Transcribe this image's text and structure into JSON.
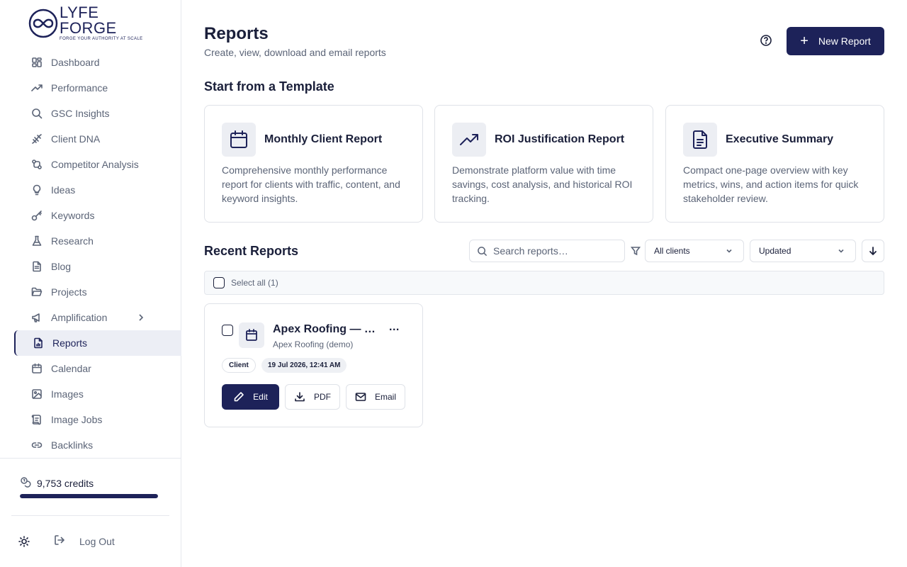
{
  "brand": {
    "name": "LYFE FORGE",
    "tagline": "FORGE YOUR AUTHORITY AT SCALE"
  },
  "sidebar": {
    "items": [
      {
        "label": "Dashboard",
        "icon": "dashboard-icon"
      },
      {
        "label": "Performance",
        "icon": "trending-up-icon"
      },
      {
        "label": "GSC Insights",
        "icon": "search-icon"
      },
      {
        "label": "Client DNA",
        "icon": "dna-icon"
      },
      {
        "label": "Competitor Analysis",
        "icon": "compare-icon"
      },
      {
        "label": "Ideas",
        "icon": "lightbulb-icon"
      },
      {
        "label": "Keywords",
        "icon": "key-icon"
      },
      {
        "label": "Research",
        "icon": "flask-icon"
      },
      {
        "label": "Blog",
        "icon": "document-icon"
      },
      {
        "label": "Projects",
        "icon": "folder-open-icon"
      },
      {
        "label": "Amplification",
        "icon": "megaphone-icon"
      },
      {
        "label": "Reports",
        "icon": "report-icon",
        "active": true
      },
      {
        "label": "Calendar",
        "icon": "calendar-icon"
      },
      {
        "label": "Images",
        "icon": "image-icon"
      },
      {
        "label": "Image Jobs",
        "icon": "image-jobs-icon"
      },
      {
        "label": "Backlinks",
        "icon": "link-icon"
      }
    ],
    "credits": {
      "label": "9,753 credits",
      "fill_fraction": 1.0
    },
    "logout_label": "Log Out"
  },
  "header": {
    "title": "Reports",
    "subtitle": "Create, view, download and email reports",
    "new_report_label": "New Report"
  },
  "templates": {
    "heading": "Start from a Template",
    "cards": [
      {
        "title": "Monthly Client Report",
        "description": "Comprehensive monthly performance report for clients with traffic, content, and keyword insights.",
        "icon": "calendar-icon"
      },
      {
        "title": "ROI Justification Report",
        "description": "Demonstrate platform value with time savings, cost analysis, and historical ROI tracking.",
        "icon": "trending-up-icon"
      },
      {
        "title": "Executive Summary",
        "description": "Compact one-page overview with key metrics, wins, and action items for quick stakeholder review.",
        "icon": "document-icon"
      }
    ]
  },
  "recent": {
    "heading": "Recent Reports",
    "search_placeholder": "Search reports…",
    "client_filter": "All clients",
    "sort_by": "Updated",
    "select_all_label": "Select all (1)",
    "reports": [
      {
        "title": "Apex Roofing — Monthly Client Report",
        "client": "Apex Roofing (demo)",
        "type_badge": "Client",
        "date": "19 Jul 2026, 12:41 AM",
        "more": "...",
        "actions": {
          "edit": "Edit",
          "pdf": "PDF",
          "email": "Email"
        }
      }
    ]
  },
  "colors": {
    "primary": "#1d2259",
    "muted_text": "#5b6477",
    "border": "#dfe2e8"
  }
}
